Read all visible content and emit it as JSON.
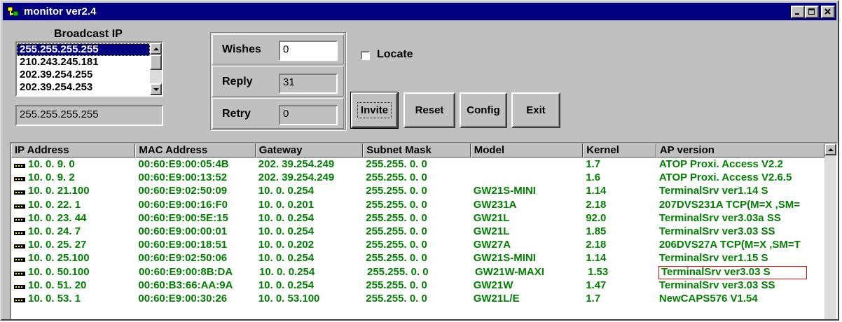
{
  "window": {
    "title": "monitor ver2.4"
  },
  "broadcast": {
    "label": "Broadcast IP",
    "items": [
      "255.255.255.255",
      "210.243.245.181",
      "202.39.254.255",
      "202.39.254.253"
    ],
    "selected_index": 0,
    "current": "255.255.255.255"
  },
  "stats": {
    "wishes_label": "Wishes",
    "wishes_value": "0",
    "reply_label": "Reply",
    "reply_value": "31",
    "retry_label": "Retry",
    "retry_value": "0"
  },
  "locate": {
    "label": "Locate",
    "checked": false
  },
  "buttons": {
    "invite": "Invite",
    "reset": "Reset",
    "config": "Config",
    "exit": "Exit"
  },
  "table": {
    "columns": [
      "IP Address",
      "MAC Address",
      "Gateway",
      "Subnet Mask",
      "Model",
      "Kernel",
      "AP version"
    ],
    "rows": [
      [
        "10. 0. 9. 0",
        "00:60:E9:00:05:4B",
        "202. 39.254.249",
        "255.255. 0. 0",
        "",
        "1.7",
        "ATOP Proxi. Access V2.2"
      ],
      [
        "10. 0. 9. 2",
        "00:60:E9:00:13:52",
        "202. 39.254.249",
        "255.255. 0. 0",
        "",
        "1.6",
        "ATOP Proxi. Access V2.6.5"
      ],
      [
        "10. 0. 21.100",
        "00:60:E9:02:50:09",
        "10. 0. 0.254",
        "255.255. 0. 0",
        "GW21S-MINI",
        "1.14",
        "TerminalSrv ver1.14 S"
      ],
      [
        "10. 0. 22. 1",
        "00:60:E9:00:16:F0",
        "10. 0. 0.201",
        "255.255. 0. 0",
        "GW231A",
        "2.18",
        "207DVS231A TCP(M=X ,SM="
      ],
      [
        "10. 0. 23. 44",
        "00:60:E9:00:5E:15",
        "10. 0. 0.254",
        "255.255. 0. 0",
        "GW21L",
        "92.0",
        "TerminalSrv ver3.03a   SS"
      ],
      [
        "10. 0. 24. 7",
        "00:60:E9:00:00:01",
        "10. 0. 0.254",
        "255.255. 0. 0",
        "GW21L",
        "1.85",
        "TerminalSrv ver3.03    SS"
      ],
      [
        "10. 0. 25. 27",
        "00:60:E9:00:18:51",
        "10. 0. 0.202",
        "255.255. 0. 0",
        "GW27A",
        "2.18",
        "206DVS27A TCP(M=X ,SM=T"
      ],
      [
        "10. 0. 25.100",
        "00:60:E9:02:50:06",
        "10. 0. 0.254",
        "255.255. 0. 0",
        "GW21S-MINI",
        "1.14",
        "TerminalSrv ver1.15 S"
      ],
      [
        "10. 0. 50.100",
        "00:60:E9:00:8B:DA",
        "10. 0. 0.254",
        "255.255. 0. 0",
        "GW21W-MAXI",
        "1.53",
        "TerminalSrv ver3.03     S"
      ],
      [
        "10. 0. 51. 20",
        "00:60:B3:66:AA:9A",
        "10. 0. 0.254",
        "255.255. 0. 0",
        "GW21W",
        "1.47",
        "TerminalSrv ver3.03    SS"
      ],
      [
        "10. 0. 53. 1",
        "00:60:E9:00:30:26",
        "10. 0. 53.100",
        "255.255. 0. 0",
        "GW21L/E",
        "1.7",
        "NewCAPS576 V1.54"
      ]
    ],
    "highlighted_row": 8
  },
  "colors": {
    "title_bar": "#000080",
    "row_text": "#008000",
    "highlight_box": "#ff0000",
    "selection": "#000080"
  },
  "icons": [
    "app-icon",
    "minimize-icon",
    "maximize-icon",
    "close-icon",
    "row-device-icon"
  ]
}
